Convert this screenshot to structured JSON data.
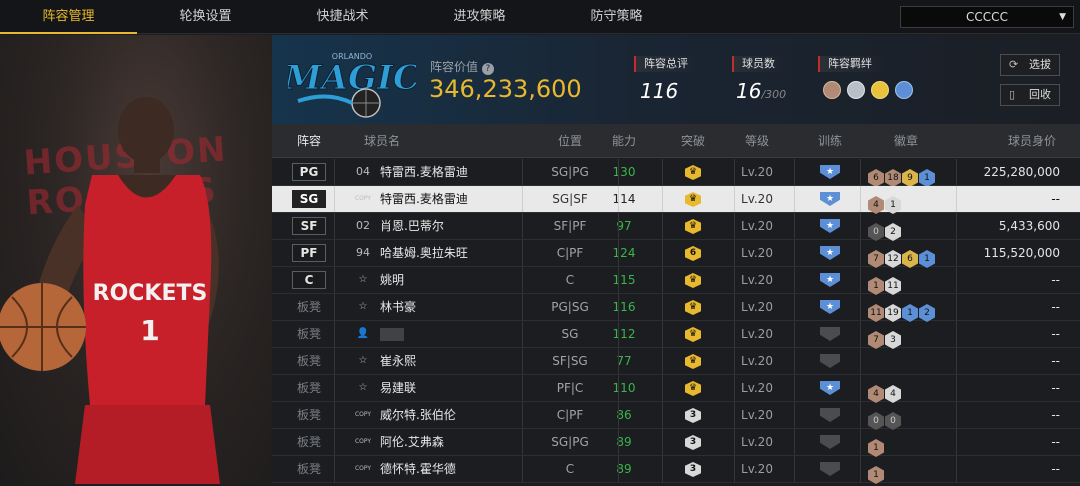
{
  "nav": {
    "tabs": [
      {
        "label": "阵容管理",
        "active": true
      },
      {
        "label": "轮换设置"
      },
      {
        "label": "快捷战术"
      },
      {
        "label": "进攻策略"
      },
      {
        "label": "防守策略"
      }
    ],
    "team_select": "CCCCC"
  },
  "header": {
    "team_logo_text": "MAGIC",
    "team_logo_sub": "ORLANDO",
    "lineup_value_label": "阵容价值",
    "lineup_value": "346,233,600",
    "overall_label": "阵容总评",
    "overall_value": "116",
    "players_label": "球员数",
    "players_value": "16",
    "players_max": "/300",
    "chemistry_label": "阵容羁绊",
    "btn_select": "选拔",
    "btn_recycle": "回收"
  },
  "left_panel": {
    "bg_text": "HOUSTON ROCKETS",
    "jersey_text": "ROCKETS",
    "jersey_number": "1"
  },
  "columns": [
    "阵容",
    "球员名",
    "位置",
    "能力",
    "突破",
    "等级",
    "训练",
    "徽章",
    "球员身价"
  ],
  "rows": [
    {
      "slot": "PG",
      "slot_type": "pos",
      "num": "04",
      "name": "特雷西.麦格雷迪",
      "pos": "SG|PG",
      "ability": "130",
      "ability_color": "#3bb54a",
      "break": "crown",
      "level": "Lv.20",
      "train": "blue",
      "medals": [
        {
          "v": "6",
          "c": "#b08a74"
        },
        {
          "v": "18",
          "c": "#b08a74"
        },
        {
          "v": "9",
          "c": "#d9b54a"
        },
        {
          "v": "1",
          "c": "#5c8fd6"
        }
      ],
      "value": "225,280,000"
    },
    {
      "slot": "SG",
      "slot_type": "pos",
      "num": "COPY",
      "name": "特雷西.麦格雷迪",
      "pos": "SG|SF",
      "ability": "114",
      "ability_color": "#222",
      "break": "crown",
      "level": "Lv.20",
      "train": "blue",
      "medals": [
        {
          "v": "4",
          "c": "#b08a74"
        },
        {
          "v": "1",
          "c": "#d8d8d8"
        }
      ],
      "value": "--",
      "selected": true
    },
    {
      "slot": "SF",
      "slot_type": "pos",
      "num": "02",
      "name": "肖恩.巴蒂尔",
      "pos": "SF|PF",
      "ability": "97",
      "ability_color": "#3bb54a",
      "break": "crown",
      "level": "Lv.20",
      "train": "blue",
      "medals": [
        {
          "v": "0",
          "c": "#555"
        },
        {
          "v": "2",
          "c": "#d8d8d8"
        }
      ],
      "value": "5,433,600"
    },
    {
      "slot": "PF",
      "slot_type": "pos",
      "num": "94",
      "name": "哈基姆.奥拉朱旺",
      "pos": "C|PF",
      "ability": "124",
      "ability_color": "#3bb54a",
      "break": "6",
      "level": "Lv.20",
      "train": "blue",
      "medals": [
        {
          "v": "7",
          "c": "#b08a74"
        },
        {
          "v": "12",
          "c": "#d8d8d8"
        },
        {
          "v": "6",
          "c": "#d9b54a"
        },
        {
          "v": "1",
          "c": "#5c8fd6"
        }
      ],
      "value": "115,520,000"
    },
    {
      "slot": "C",
      "slot_type": "pos",
      "num": "star",
      "name": "姚明",
      "pos": "C",
      "ability": "115",
      "ability_color": "#3bb54a",
      "break": "crown",
      "level": "Lv.20",
      "train": "blue",
      "medals": [
        {
          "v": "1",
          "c": "#b08a74"
        },
        {
          "v": "11",
          "c": "#d8d8d8"
        }
      ],
      "value": "--"
    },
    {
      "slot": "板凳",
      "slot_type": "bench",
      "num": "star",
      "name": "林书豪",
      "pos": "PG|SG",
      "ability": "116",
      "ability_color": "#3bb54a",
      "break": "crown",
      "level": "Lv.20",
      "train": "blue",
      "medals": [
        {
          "v": "11",
          "c": "#b08a74"
        },
        {
          "v": "19",
          "c": "#d8d8d8"
        },
        {
          "v": "1",
          "c": "#5c8fd6"
        },
        {
          "v": "2",
          "c": "#5c8fd6"
        }
      ],
      "value": "--"
    },
    {
      "slot": "板凳",
      "slot_type": "bench",
      "num": "person",
      "name": "",
      "pos": "SG",
      "ability": "112",
      "ability_color": "#3bb54a",
      "break": "crown",
      "level": "Lv.20",
      "train": "gray",
      "medals": [
        {
          "v": "7",
          "c": "#b08a74"
        },
        {
          "v": "3",
          "c": "#d8d8d8"
        }
      ],
      "value": "--"
    },
    {
      "slot": "板凳",
      "slot_type": "bench",
      "num": "star",
      "name": "崔永熙",
      "pos": "SF|SG",
      "ability": "77",
      "ability_color": "#3bb54a",
      "break": "crown",
      "level": "Lv.20",
      "train": "gray",
      "medals": [],
      "value": "--"
    },
    {
      "slot": "板凳",
      "slot_type": "bench",
      "num": "star",
      "name": "易建联",
      "pos": "PF|C",
      "ability": "110",
      "ability_color": "#3bb54a",
      "break": "crown",
      "level": "Lv.20",
      "train": "blue",
      "medals": [
        {
          "v": "4",
          "c": "#b08a74"
        },
        {
          "v": "4",
          "c": "#d8d8d8"
        }
      ],
      "value": "--"
    },
    {
      "slot": "板凳",
      "slot_type": "bench",
      "num": "COPY",
      "name": "威尔特.张伯伦",
      "pos": "C|PF",
      "ability": "86",
      "ability_color": "#3bb54a",
      "break": "3",
      "level": "Lv.20",
      "train": "gray",
      "medals": [
        {
          "v": "0",
          "c": "#555"
        },
        {
          "v": "0",
          "c": "#555"
        }
      ],
      "value": "--"
    },
    {
      "slot": "板凳",
      "slot_type": "bench",
      "num": "COPY",
      "name": "阿伦.艾弗森",
      "pos": "SG|PG",
      "ability": "89",
      "ability_color": "#3bb54a",
      "break": "3",
      "level": "Lv.20",
      "train": "gray",
      "medals": [
        {
          "v": "1",
          "c": "#b08a74"
        }
      ],
      "value": "--"
    },
    {
      "slot": "板凳",
      "slot_type": "bench",
      "num": "COPY",
      "name": "德怀特.霍华德",
      "pos": "C",
      "ability": "89",
      "ability_color": "#3bb54a",
      "break": "3",
      "level": "Lv.20",
      "train": "gray",
      "medals": [
        {
          "v": "1",
          "c": "#b08a74"
        }
      ],
      "value": "--"
    }
  ]
}
